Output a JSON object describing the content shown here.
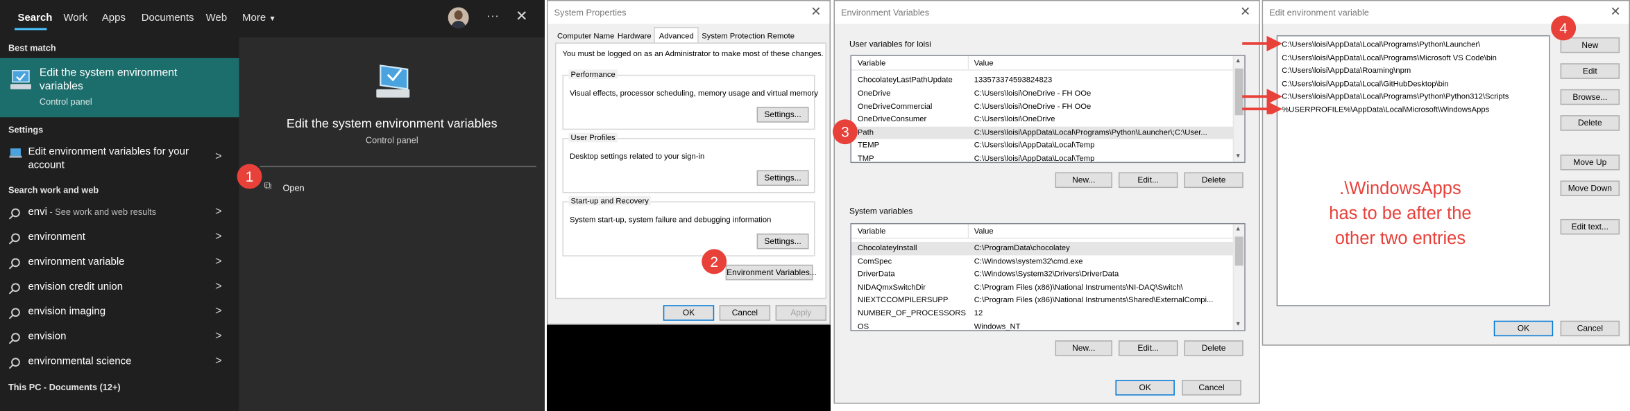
{
  "search_panel": {
    "tabs": [
      "Search",
      "Work",
      "Apps",
      "Documents",
      "Web",
      "More"
    ],
    "best_match_header": "Best match",
    "best_match": {
      "title": "Edit the system environment variables",
      "subtitle": "Control panel"
    },
    "settings_header": "Settings",
    "settings_item": "Edit environment variables for your account",
    "work_web_header": "Search work and web",
    "suggestions": [
      {
        "text": "envi",
        "suffix": " - See work and web results"
      },
      {
        "text": "environment",
        "suffix": ""
      },
      {
        "text": "environment variable",
        "suffix": ""
      },
      {
        "text": "envision credit union",
        "suffix": ""
      },
      {
        "text": "envision imaging",
        "suffix": ""
      },
      {
        "text": "envision",
        "suffix": ""
      },
      {
        "text": "environmental science",
        "suffix": ""
      }
    ],
    "documents_header": "This PC - Documents (12+)",
    "preview": {
      "title": "Edit the system environment variables",
      "subtitle": "Control panel",
      "open_label": "Open"
    }
  },
  "system_properties": {
    "title": "System Properties",
    "tabs": [
      "Computer Name",
      "Hardware",
      "Advanced",
      "System Protection",
      "Remote"
    ],
    "active_tab": "Advanced",
    "admin_note": "You must be logged on as an Administrator to make most of these changes.",
    "groups": [
      {
        "title": "Performance",
        "desc": "Visual effects, processor scheduling, memory usage and virtual memory",
        "button": "Settings..."
      },
      {
        "title": "User Profiles",
        "desc": "Desktop settings related to your sign-in",
        "button": "Settings..."
      },
      {
        "title": "Start-up and Recovery",
        "desc": "System start-up, system failure and debugging information",
        "button": "Settings..."
      }
    ],
    "env_button": "Environment Variables...",
    "ok": "OK",
    "cancel": "Cancel",
    "apply": "Apply"
  },
  "environment_variables": {
    "title": "Environment Variables",
    "user_label": "User variables for loisi",
    "columns": [
      "Variable",
      "Value"
    ],
    "user_vars": [
      {
        "name": "ChocolateyLastPathUpdate",
        "value": "133573374593824823"
      },
      {
        "name": "OneDrive",
        "value": "C:\\Users\\loisi\\OneDrive - FH OOe"
      },
      {
        "name": "OneDriveCommercial",
        "value": "C:\\Users\\loisi\\OneDrive - FH OOe"
      },
      {
        "name": "OneDriveConsumer",
        "value": "C:\\Users\\loisi\\OneDrive"
      },
      {
        "name": "Path",
        "value": "C:\\Users\\loisi\\AppData\\Local\\Programs\\Python\\Launcher\\;C:\\User..."
      },
      {
        "name": "TEMP",
        "value": "C:\\Users\\loisi\\AppData\\Local\\Temp"
      },
      {
        "name": "TMP",
        "value": "C:\\Users\\loisi\\AppData\\Local\\Temp"
      }
    ],
    "system_label": "System variables",
    "system_vars": [
      {
        "name": "ChocolateyInstall",
        "value": "C:\\ProgramData\\chocolatey"
      },
      {
        "name": "ComSpec",
        "value": "C:\\Windows\\system32\\cmd.exe"
      },
      {
        "name": "DriverData",
        "value": "C:\\Windows\\System32\\Drivers\\DriverData"
      },
      {
        "name": "NIDAQmxSwitchDir",
        "value": "C:\\Program Files (x86)\\National Instruments\\NI-DAQ\\Switch\\"
      },
      {
        "name": "NIEXTCCOMPILERSUPP",
        "value": "C:\\Program Files (x86)\\National Instruments\\Shared\\ExternalCompi..."
      },
      {
        "name": "NUMBER_OF_PROCESSORS",
        "value": "12"
      },
      {
        "name": "OS",
        "value": "Windows_NT"
      }
    ],
    "new": "New...",
    "edit": "Edit...",
    "delete": "Delete",
    "ok": "OK",
    "cancel": "Cancel"
  },
  "edit_env": {
    "title": "Edit environment variable",
    "entries": [
      "C:\\Users\\loisi\\AppData\\Local\\Programs\\Python\\Launcher\\",
      "C:\\Users\\loisi\\AppData\\Local\\Programs\\Microsoft VS Code\\bin",
      "C:\\Users\\loisi\\AppData\\Roaming\\npm",
      "C:\\Users\\loisi\\AppData\\Local\\GitHubDesktop\\bin",
      "C:\\Users\\loisi\\AppData\\Local\\Programs\\Python\\Python312\\Scripts",
      "%USERPROFILE%\\AppData\\Local\\Microsoft\\WindowsApps"
    ],
    "buttons": [
      "New",
      "Edit",
      "Browse...",
      "Delete",
      "Move Up",
      "Move Down",
      "Edit text..."
    ],
    "ok": "OK",
    "cancel": "Cancel",
    "annotation": [
      ".\\WindowsApps",
      "has to be after the",
      "other two entries"
    ]
  },
  "badges": [
    "1",
    "2",
    "3",
    "4"
  ],
  "colors": {
    "accent_teal": "#1c6e6c",
    "annotation_red": "#e8413a",
    "search_bg": "#1f1f1f"
  }
}
